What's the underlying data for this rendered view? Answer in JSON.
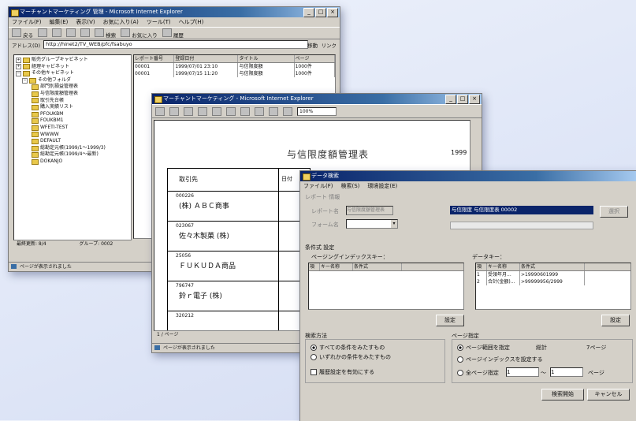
{
  "explorer": {
    "title": "マーチャントマーケティング 管理 - Microsoft Internet Explorer",
    "menu": [
      "ファイル(F)",
      "編集(E)",
      "表示(V)",
      "お気に入り(A)",
      "ツール(T)",
      "ヘルプ(H)"
    ],
    "toolbar": [
      "戻る",
      "進む",
      "中止",
      "更新",
      "ホーム",
      "検索",
      "お気に入り",
      "履歴"
    ],
    "address_label": "アドレス(D)",
    "address": "http://hinet2/TV_WEB/pfc/fsabuyo",
    "go_label": "移動",
    "links_label": "リンク",
    "tree": [
      "販売グループキャビネット",
      "経理キャビネット",
      "その他キャビネット",
      "その他フォルダ",
      "部門別損益管理表",
      "与信限度額管理表",
      "取引先台帳",
      "購入実績リスト",
      "PFOUKBM",
      "FOUKBM1",
      "WFETI-TEST",
      "WWWW",
      "DEFAULT",
      "総勘定元帳(1999/1〜1999/3)",
      "総勘定元帳(1999/4〜最新)",
      "DOKANJO"
    ],
    "grid_headers": [
      "レポート番号",
      "登録日付",
      "タイトル",
      "ページ"
    ],
    "grid_rows": [
      [
        "00001",
        "1999/07/01 23:10",
        "与信限度額",
        "1000件"
      ],
      [
        "00001",
        "1999/07/15 11:20",
        "与信限度額",
        "1000件"
      ]
    ],
    "status_left": "最終更新: 8/4",
    "status_mid": "グループ: 0002",
    "status_bottom": "ページが表示されました"
  },
  "viewer": {
    "title": "マーチャントマーケティング - Microsoft Internet Explorer",
    "zoom": "100%",
    "report_title": "与信限度額管理表",
    "report_year": "1999",
    "col_header": "取引先",
    "col2_header": "日付",
    "rows": [
      {
        "code": "000226",
        "name": "(株) ＡＢＣ商事"
      },
      {
        "code": "023067",
        "name": "佐々木製菓 (株)"
      },
      {
        "code": "25056",
        "name": "ＦＵＫＵＤＡ商品"
      },
      {
        "code": "796747",
        "name": "鈴ｒ電子 (株)"
      },
      {
        "code": "320212",
        "name": ""
      }
    ],
    "page_indicator": "1 / ページ",
    "status_bottom": "ページが表示されました"
  },
  "search": {
    "title": "データ検索",
    "menu": [
      "ファイル(F)",
      "検索(S)",
      "環境設定(E)"
    ],
    "report_label": "レポート 情報",
    "report_no_label": "レポート名",
    "report_no_value": "与信限度額管理表",
    "form_label": "フォーム名",
    "selected_report": "与信限度 与信限度表 00002",
    "select_button": "選択",
    "conditions_label": "条件式 設定",
    "paging_key_label": "ページングインデックスキー：",
    "data_key_label": "データキー：",
    "paging_cols": [
      "項",
      "キー名称",
      "条件式"
    ],
    "data_cols": [
      "項",
      "キー名称",
      "条件式"
    ],
    "data_rows": [
      [
        "1",
        "受領年月...",
        ">19990601999"
      ],
      [
        "2",
        "合計(金額)...",
        ">99999956/2999"
      ]
    ],
    "set_button_left": "設定",
    "set_button_right": "設定",
    "method_label": "検索方法",
    "method_all": "すべての条件をみたすもの",
    "method_any": "いずれかの条件をみたすもの",
    "fuzzy_label": "履歴設定を有効にする",
    "page_spec_label": "ページ指定",
    "page_range_label": "ページ範囲を指定",
    "total_label": "総計",
    "total_value": "7ページ",
    "page_index_label": "ページインデックスを設定する",
    "all_pages_label": "全ページ指定",
    "page_from": "1",
    "tilde": "〜",
    "page_to": "1",
    "page_unit": "ページ",
    "start_button": "検索開始",
    "cancel_button": "キャンセル"
  }
}
